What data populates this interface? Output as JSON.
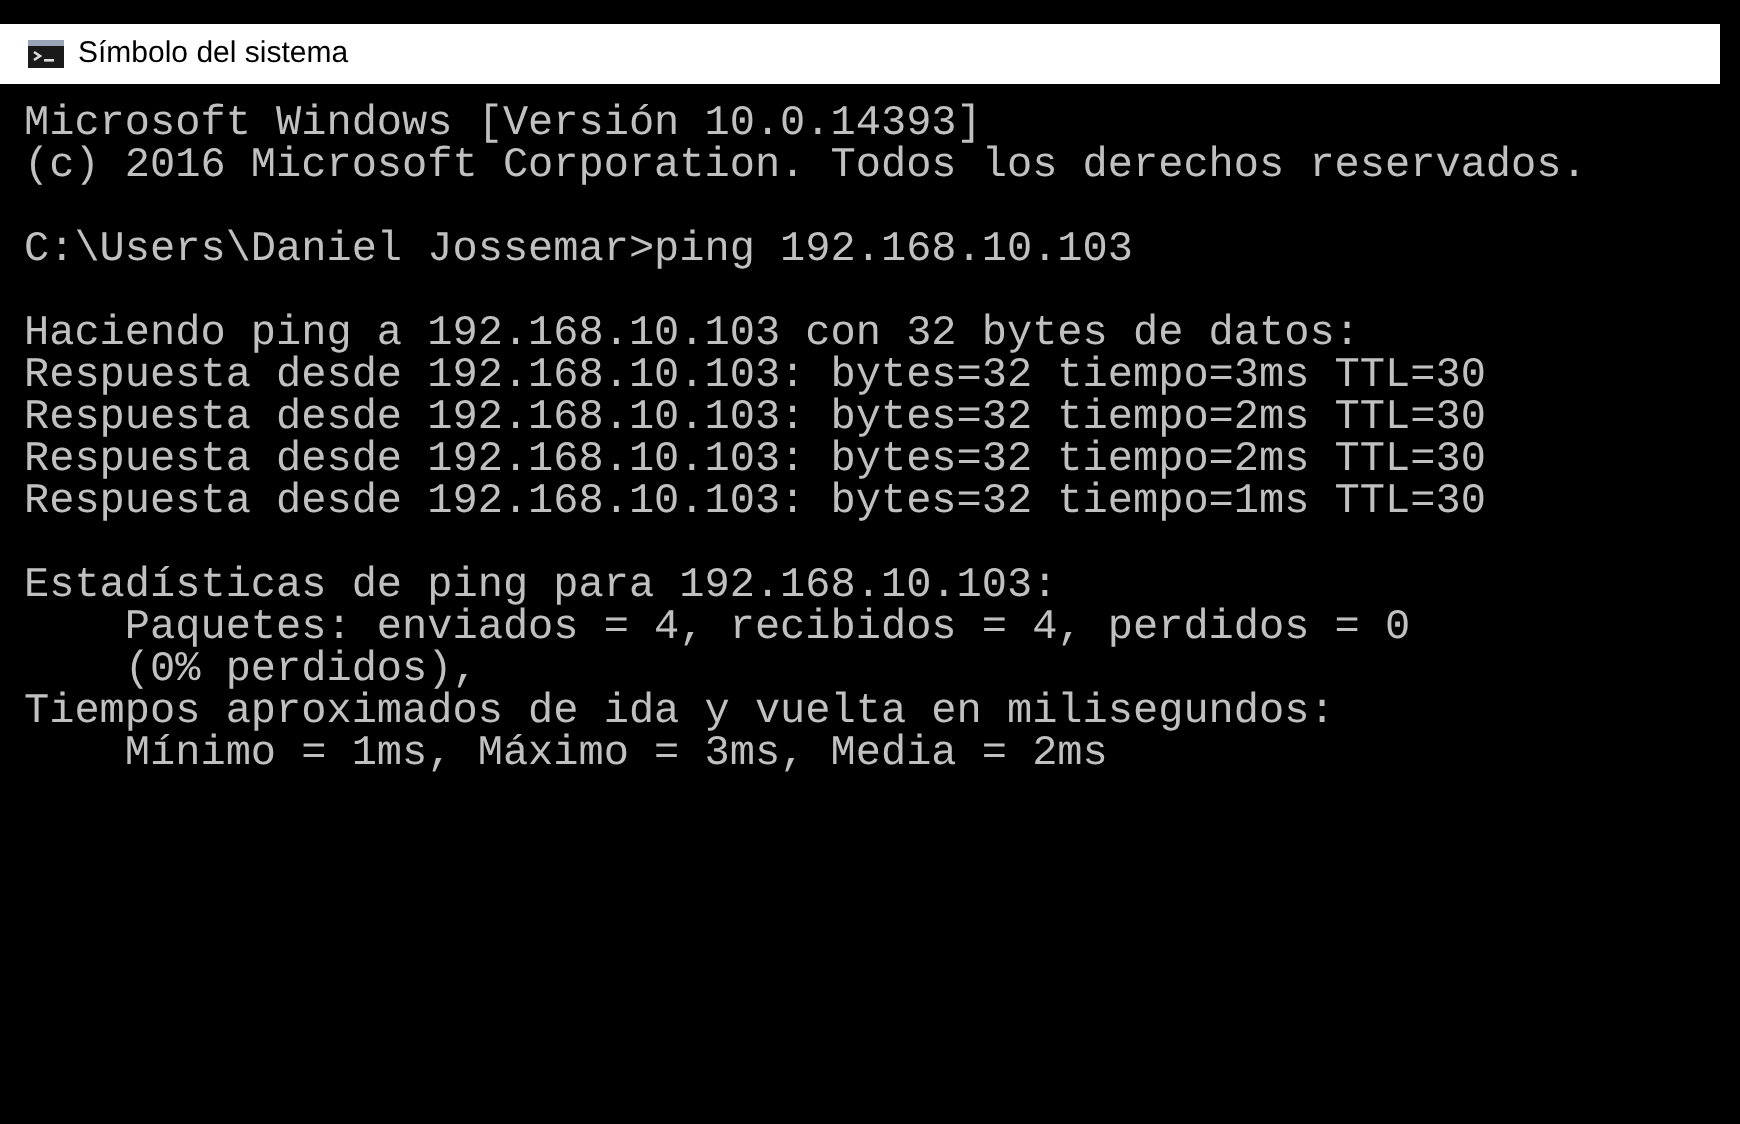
{
  "window": {
    "title": "Símbolo del sistema"
  },
  "console": {
    "blocks": [
      [
        "Microsoft Windows [Versión 10.0.14393]",
        "(c) 2016 Microsoft Corporation. Todos los derechos reservados."
      ],
      [
        "C:\\Users\\Daniel Jossemar>ping 192.168.10.103"
      ],
      [
        "Haciendo ping a 192.168.10.103 con 32 bytes de datos:",
        "Respuesta desde 192.168.10.103: bytes=32 tiempo=3ms TTL=30",
        "Respuesta desde 192.168.10.103: bytes=32 tiempo=2ms TTL=30",
        "Respuesta desde 192.168.10.103: bytes=32 tiempo=2ms TTL=30",
        "Respuesta desde 192.168.10.103: bytes=32 tiempo=1ms TTL=30"
      ],
      [
        "Estadísticas de ping para 192.168.10.103:",
        "    Paquetes: enviados = 4, recibidos = 4, perdidos = 0",
        "    (0% perdidos),",
        "Tiempos aproximados de ida y vuelta en milisegundos:",
        "    Mínimo = 1ms, Máximo = 3ms, Media = 2ms"
      ]
    ]
  }
}
